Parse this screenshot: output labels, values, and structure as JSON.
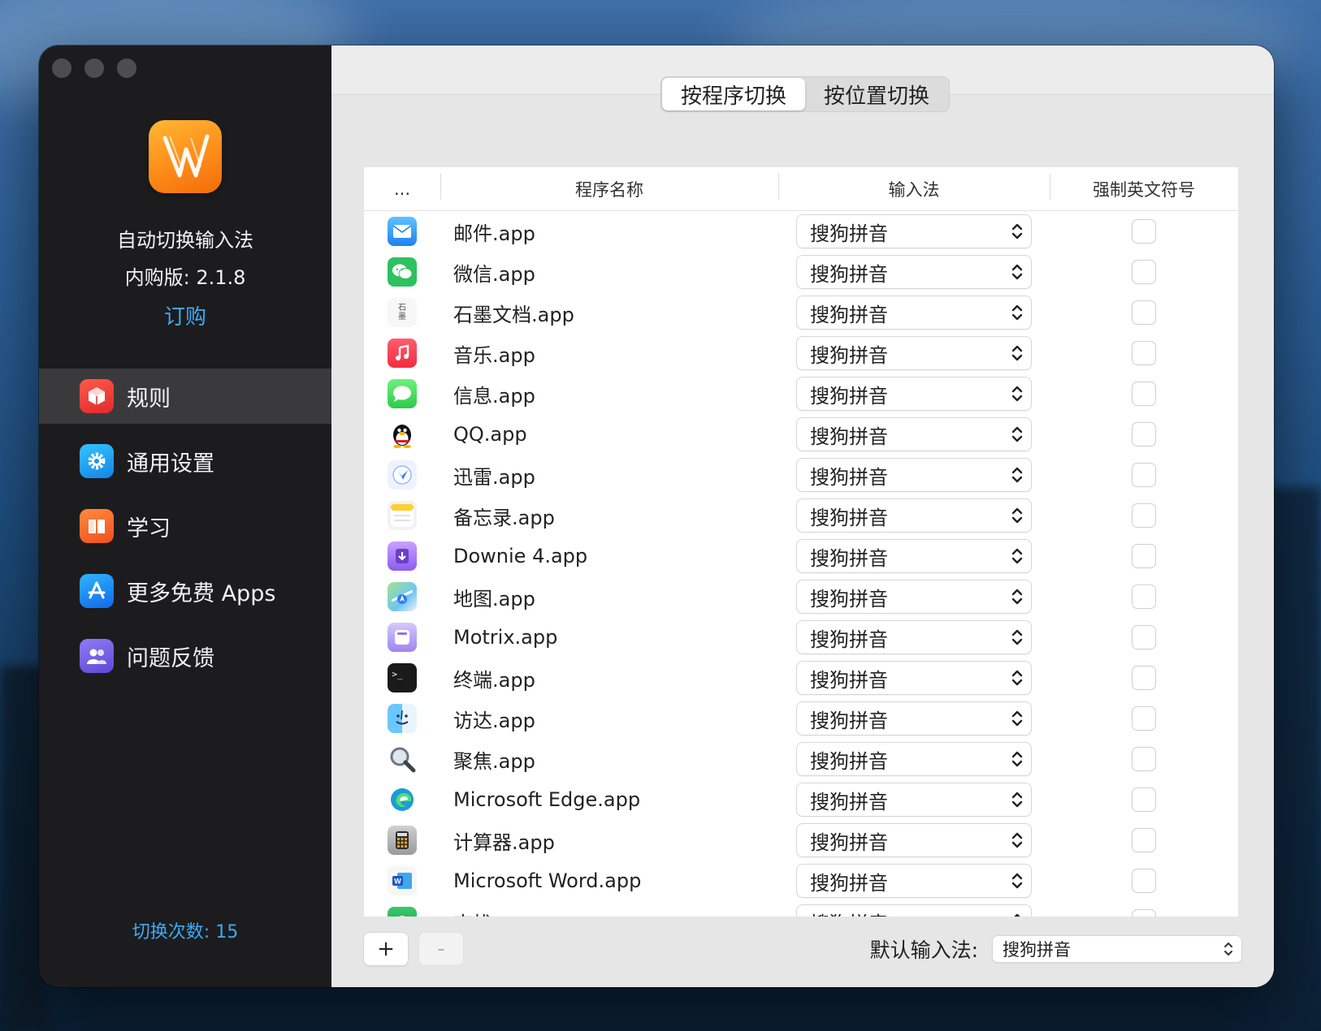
{
  "window": {
    "tabs": [
      {
        "label": "按程序切换",
        "active": true
      },
      {
        "label": "按位置切换",
        "active": false
      }
    ]
  },
  "sidebar": {
    "app_name": "自动切换输入法",
    "version": "内购版: 2.1.8",
    "buy_link": "订购",
    "switch_count": "切换次数: 15",
    "items": [
      {
        "label": "规则",
        "icon": "cube-icon",
        "active": true,
        "color": "#ef3b3b"
      },
      {
        "label": "通用设置",
        "icon": "gear-icon",
        "active": false,
        "color": "#1fa0f0"
      },
      {
        "label": "学习",
        "icon": "book-icon",
        "active": false,
        "color": "#f7642b"
      },
      {
        "label": "更多免费 Apps",
        "icon": "app-store-icon",
        "active": false,
        "color": "#1b8ef2"
      },
      {
        "label": "问题反馈",
        "icon": "people-icon",
        "active": false,
        "color": "#7b61e8"
      }
    ]
  },
  "table": {
    "headers": [
      "...",
      "程序名称",
      "输入法",
      "强制英文符号"
    ],
    "rows": [
      {
        "name": "邮件.app",
        "icon": "mail-icon",
        "input": "搜狗拼音",
        "force_english": false
      },
      {
        "name": "微信.app",
        "icon": "wechat-icon",
        "input": "搜狗拼音",
        "force_english": false
      },
      {
        "name": "石墨文档.app",
        "icon": "shimo-icon",
        "input": "搜狗拼音",
        "force_english": false
      },
      {
        "name": "音乐.app",
        "icon": "music-icon",
        "input": "搜狗拼音",
        "force_english": false
      },
      {
        "name": "信息.app",
        "icon": "messages-icon",
        "input": "搜狗拼音",
        "force_english": false
      },
      {
        "name": "QQ.app",
        "icon": "qq-icon",
        "input": "搜狗拼音",
        "force_english": false
      },
      {
        "name": "迅雷.app",
        "icon": "xunlei-icon",
        "input": "搜狗拼音",
        "force_english": false
      },
      {
        "name": "备忘录.app",
        "icon": "notes-icon",
        "input": "搜狗拼音",
        "force_english": false
      },
      {
        "name": "Downie 4.app",
        "icon": "downie-icon",
        "input": "搜狗拼音",
        "force_english": false
      },
      {
        "name": "地图.app",
        "icon": "maps-icon",
        "input": "搜狗拼音",
        "force_english": false
      },
      {
        "name": "Motrix.app",
        "icon": "motrix-icon",
        "input": "搜狗拼音",
        "force_english": false
      },
      {
        "name": "终端.app",
        "icon": "terminal-icon",
        "input": "搜狗拼音",
        "force_english": false
      },
      {
        "name": "访达.app",
        "icon": "finder-icon",
        "input": "搜狗拼音",
        "force_english": false
      },
      {
        "name": "聚焦.app",
        "icon": "spotlight-icon",
        "input": "搜狗拼音",
        "force_english": false
      },
      {
        "name": "Microsoft Edge.app",
        "icon": "edge-icon",
        "input": "搜狗拼音",
        "force_english": false
      },
      {
        "name": "计算器.app",
        "icon": "calculator-icon",
        "input": "搜狗拼音",
        "force_english": false
      },
      {
        "name": "Microsoft Word.app",
        "icon": "word-icon",
        "input": "搜狗拼音",
        "force_english": false
      },
      {
        "name": "查找",
        "icon": "findmy-icon",
        "input": "搜狗拼音",
        "force_english": false
      }
    ]
  },
  "bottom": {
    "add_label": "+",
    "remove_label": "-",
    "default_label": "默认输入法:",
    "default_value": "搜狗拼音"
  }
}
